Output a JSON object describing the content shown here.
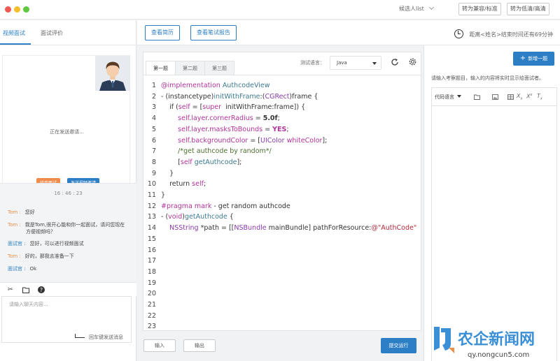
{
  "titlebar": {
    "candidate_select": "候选人list",
    "btn_standard": "转为兼容/标准",
    "btn_quality": "转为低清/高清"
  },
  "left": {
    "tabs": [
      "视频面试",
      "面试评价"
    ],
    "video_status": "正在发送邀请...",
    "btn_end": "结束面试",
    "btn_send_invite": "发送视频邀请",
    "chat_time": "16 : 46 : 23",
    "messages": [
      {
        "who": "Tom :",
        "text": "您好"
      },
      {
        "who": "Tom :",
        "text": "我是Tom,很开心能和你一起面试，请问您现在方便视频吗？"
      },
      {
        "who": "面试官 :",
        "text": "您好，可以进行视频面试"
      },
      {
        "who": "Tom :",
        "text": "好的，那我去准备一下"
      },
      {
        "who": "面试官 :",
        "text": "Ok"
      }
    ],
    "input_placeholder": "请输入聊天内容...",
    "send_hint": "回车键发送消息"
  },
  "middle": {
    "btn_resume": "查看简历",
    "btn_written_report": "查看笔试报告",
    "timer_text": "距离<姓名>结束时间还有69分钟",
    "editor_tabs": [
      "第一题",
      "第二题",
      "第三题"
    ],
    "lang_label": "测试语言：",
    "lang_value": "Java",
    "line_numbers": [
      "1",
      "2",
      "3",
      "4",
      "5",
      "6",
      "7",
      "8",
      "9",
      "10",
      "11",
      "12",
      "13",
      "14",
      "15",
      "16",
      "17",
      "18",
      "19",
      "20",
      "21",
      "22",
      "23"
    ],
    "btn_input": "输入",
    "btn_output": "输出",
    "btn_submit": "提交运行"
  },
  "right": {
    "btn_add": "新增一题",
    "hint": "请输入考察题目，输入的内容将实时显示给面试者。",
    "code_lang_select": "代码语言"
  },
  "watermark": {
    "text": "农企新闻网",
    "url": "qy.nongcun5.com"
  },
  "icons": [
    "clock-icon",
    "refresh-icon",
    "settings-icon",
    "scissors-icon",
    "folder-icon",
    "help-icon",
    "enter-icon",
    "image-icon",
    "table-icon",
    "plus-icon"
  ]
}
